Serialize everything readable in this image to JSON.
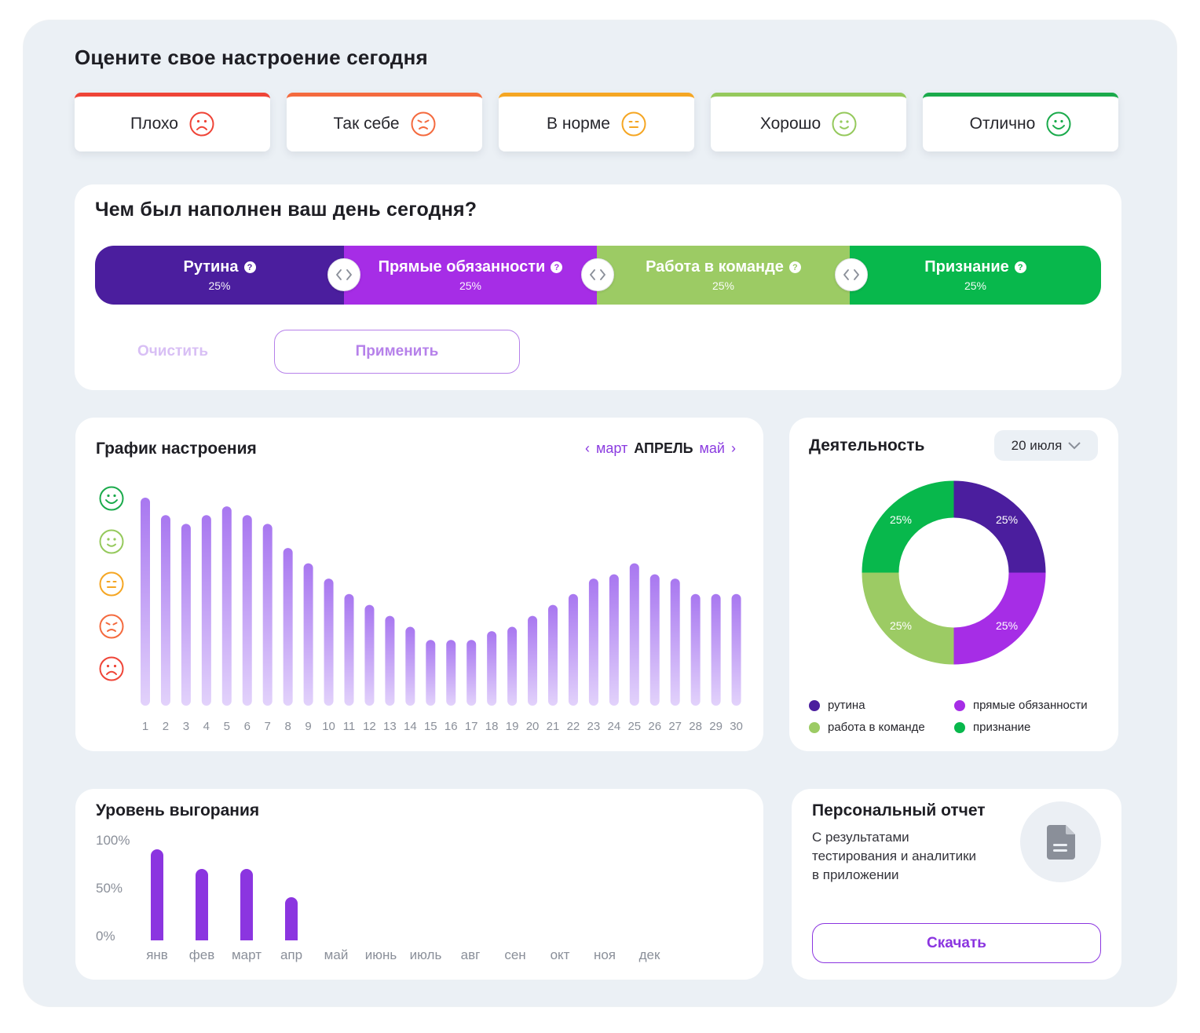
{
  "mood": {
    "title": "Оцените свое настроение сегодня",
    "options": [
      {
        "label": "Плохо",
        "icon": "very-sad-face-icon",
        "color": "#ef4437"
      },
      {
        "label": "Так себе",
        "icon": "sad-face-icon",
        "color": "#f46a3e"
      },
      {
        "label": "В норме",
        "icon": "neutral-face-icon",
        "color": "#f5a623"
      },
      {
        "label": "Хорошо",
        "icon": "smile-face-icon",
        "color": "#95c95c"
      },
      {
        "label": "Отлично",
        "icon": "big-smile-face-icon",
        "color": "#1aaa4b"
      }
    ]
  },
  "day": {
    "title": "Чем был наполнен ваш день сегодня?",
    "segments": [
      {
        "label": "Рутина",
        "percent": "25%",
        "color": "#4b1e9e"
      },
      {
        "label": "Прямые обязанности",
        "percent": "25%",
        "color": "#a62de6"
      },
      {
        "label": "Работа в команде",
        "percent": "25%",
        "color": "#9ccb64"
      },
      {
        "label": "Признание",
        "percent": "25%",
        "color": "#08b84c"
      }
    ],
    "clear_label": "Очистить",
    "apply_label": "Применить"
  },
  "mood_chart": {
    "title": "График настроения",
    "prev_month": "март",
    "current_month": "АПРЕЛЬ",
    "next_month": "май"
  },
  "chart_data": [
    {
      "type": "bar",
      "title": "График настроения",
      "categories": [
        "1",
        "2",
        "3",
        "4",
        "5",
        "6",
        "7",
        "8",
        "9",
        "10",
        "11",
        "12",
        "13",
        "14",
        "15",
        "16",
        "17",
        "18",
        "19",
        "20",
        "21",
        "22",
        "23",
        "24",
        "25",
        "26",
        "27",
        "28",
        "29",
        "30"
      ],
      "values": [
        4.75,
        4.35,
        4.15,
        4.35,
        4.55,
        4.35,
        4.15,
        3.6,
        3.25,
        2.9,
        2.55,
        2.3,
        2.05,
        1.8,
        1.5,
        1.5,
        1.5,
        1.7,
        1.8,
        2.05,
        2.3,
        2.55,
        2.9,
        3.0,
        3.25,
        3.0,
        2.9,
        2.55,
        2.55,
        2.55
      ],
      "ylim": [
        0,
        5
      ]
    },
    {
      "type": "pie",
      "title": "Деятельность",
      "categories": [
        "рутина",
        "прямые обязанности",
        "работа в команде",
        "признание"
      ],
      "values": [
        25,
        25,
        25,
        25
      ],
      "colors": [
        "#4b1e9e",
        "#a62de6",
        "#9ccb64",
        "#08b84c"
      ],
      "labels": [
        "25%",
        "25%",
        "25%",
        "25%"
      ]
    },
    {
      "type": "bar",
      "title": "Уровень выгорания",
      "categories": [
        "янв",
        "фев",
        "март",
        "апр",
        "май",
        "июнь",
        "июль",
        "авг",
        "сен",
        "окт",
        "ноя",
        "дек"
      ],
      "values": [
        95,
        75,
        75,
        45,
        null,
        null,
        null,
        null,
        null,
        null,
        null,
        null
      ],
      "yticks": [
        "100%",
        "50%",
        "0%"
      ],
      "ylim": [
        0,
        100
      ]
    }
  ],
  "activity": {
    "title": "Деятельность",
    "date": "20 июля"
  },
  "burnout": {
    "title": "Уровень выгорания"
  },
  "report": {
    "title": "Персональный отчет",
    "line1": "С результатами",
    "line2": "тестирования и аналитики",
    "line3": "в приложении",
    "download_label": "Скачать"
  }
}
